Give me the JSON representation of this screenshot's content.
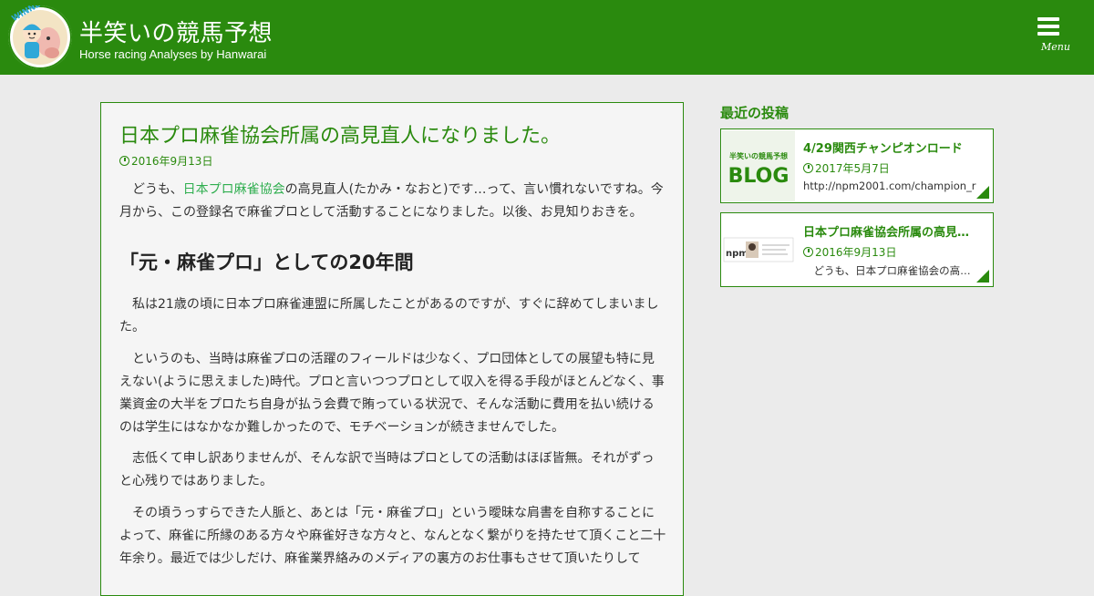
{
  "header": {
    "site_title": "半笑いの競馬予想",
    "tagline": "Horse racing Analyses by Hanwarai",
    "logo_text": "WINNER",
    "menu_label": "Menu",
    "menu_icon": "hamburger-icon",
    "background_color": "#2a8a0e"
  },
  "article": {
    "title": "日本プロ麻雀協会所属の高見直人になりました。",
    "date": "2016年9月13日",
    "intro": {
      "before_link": "どうも、",
      "link_text": "日本プロ麻雀協会",
      "after_link": "の高見直人(たかみ・なおと)です…って、言い慣れないですね。今月から、この登録名で麻雀プロとして活動することになりました。以後、お見知りおきを。"
    },
    "heading": "「元・麻雀プロ」としての20年間",
    "paragraphs": [
      "私は21歳の頃に日本プロ麻雀連盟に所属したことがあるのですが、すぐに辞めてしまいました。",
      "というのも、当時は麻雀プロの活躍のフィールドは少なく、プロ団体としての展望も特に見えない(ように思えました)時代。プロと言いつつプロとして収入を得る手段がほとんどなく、事業資金の大半をプロたち自身が払う会費で賄っている状況で、そんな活動に費用を払い続けるのは学生にはなかなか難しかったので、モチベーションが続きませんでした。",
      "志低くて申し訳ありませんが、そんな訳で当時はプロとしての活動はほぼ皆無。それがずっと心残りではありました。",
      "その頃うっすらできた人脈と、あとは「元・麻雀プロ」という曖昧な肩書を自称することによって、麻雀に所縁のある方々や麻雀好きな方々と、なんとなく繋がりを持たせて頂くこと二十年余り。最近では少しだけ、麻雀業界絡みのメディアの裏方のお仕事もさせて頂いたりして"
    ]
  },
  "sidebar": {
    "heading": "最近の投稿",
    "posts": [
      {
        "title": "4/29関西チャンピオンロード",
        "date": "2017年5月7日",
        "excerpt": "http://npm2001.com/champion_r",
        "thumb_top": "半笑いの競馬予想",
        "thumb_text": "BLOG"
      },
      {
        "title": "日本プロ麻雀協会所属の高見直人",
        "date": "2016年9月13日",
        "excerpt": "　どうも、日本プロ麻雀協会の高見直人",
        "thumb_text": "npm"
      }
    ]
  }
}
